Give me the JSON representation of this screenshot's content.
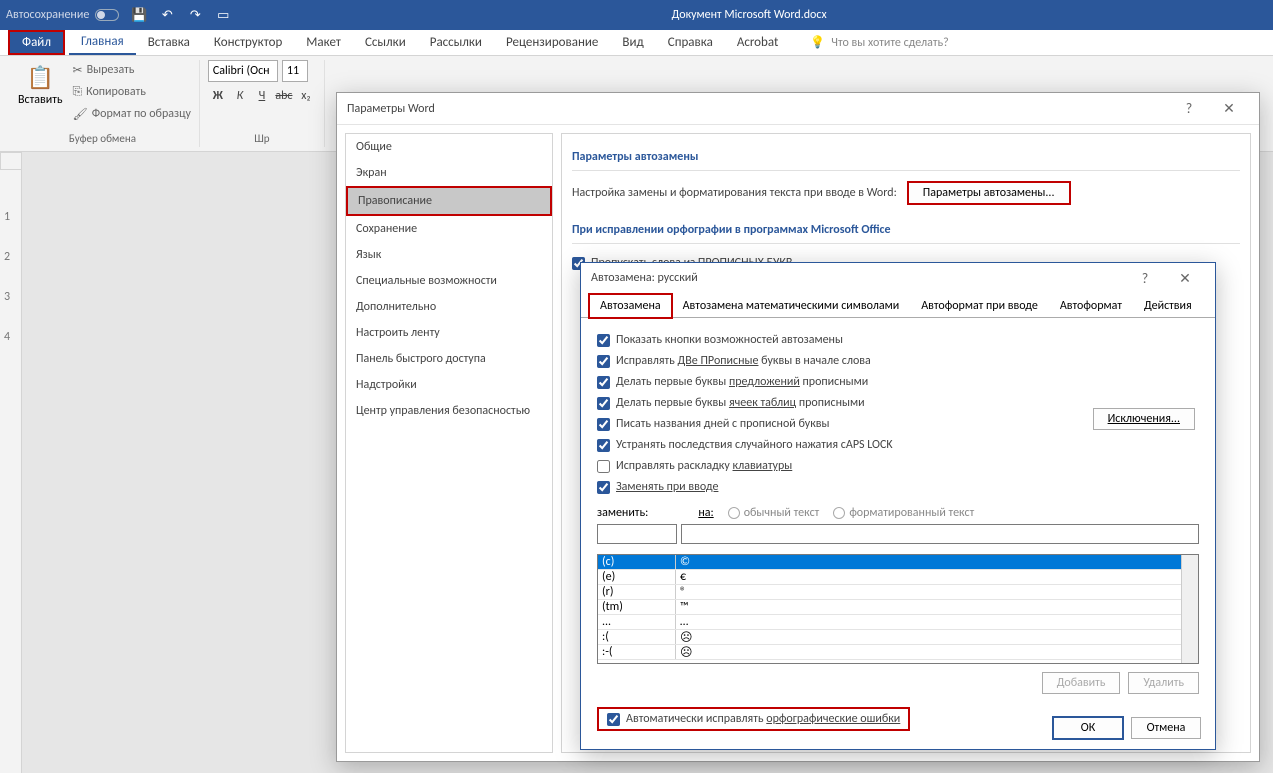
{
  "titlebar": {
    "autosave_label": "Автосохранение",
    "doc_title": "Документ Microsoft Word.docx"
  },
  "tabs": {
    "file": "Файл",
    "home": "Главная",
    "insert": "Вставка",
    "design": "Конструктор",
    "layout": "Макет",
    "references": "Ссылки",
    "mailings": "Рассылки",
    "review": "Рецензирование",
    "view": "Вид",
    "help": "Справка",
    "acrobat": "Acrobat",
    "tell_me": "Что вы хотите сделать?"
  },
  "ribbon": {
    "paste": "Вставить",
    "cut": "Вырезать",
    "copy": "Копировать",
    "format_painter": "Формат по образцу",
    "clipboard_group": "Буфер обмена",
    "font_name": "Calibri (Осн",
    "font_size": "11",
    "font_group": "Шр"
  },
  "word_options": {
    "title": "Параметры Word",
    "sidebar": {
      "general": "Общие",
      "display": "Экран",
      "proofing": "Правописание",
      "save": "Сохранение",
      "language": "Язык",
      "ease": "Специальные возможности",
      "advanced": "Дополнительно",
      "customize_ribbon": "Настроить ленту",
      "qat": "Панель быстрого доступа",
      "addins": "Надстройки",
      "trust": "Центр управления безопасностью"
    },
    "content": {
      "sec1": "Параметры автозамены",
      "sec1_text": "Настройка замены и форматирования текста при вводе в Word:",
      "sec1_btn": "Параметры автозамены...",
      "sec2": "При исправлении орфографии в программах Microsoft Office",
      "chk_caps": "Пропускать слова из ПРОПИСНЫХ БУКВ"
    }
  },
  "autocorrect": {
    "title": "Автозамена: русский",
    "tabs": {
      "auto": "Автозамена",
      "math": "Автозамена математическими символами",
      "afmt_type": "Автоформат при вводе",
      "afmt": "Автоформат",
      "actions": "Действия"
    },
    "show_buttons": "Показать кнопки возможностей автозамены",
    "correct_two_caps_a": "Исправлять ",
    "correct_two_caps_b": "ДВе ПРописные",
    "correct_two_caps_c": " буквы в начале слова",
    "capitalize_sentences_a": "Делать первые буквы ",
    "capitalize_sentences_b": "предложений",
    "capitalize_sentences_c": " прописными",
    "capitalize_cells_a": "Делать первые буквы ",
    "capitalize_cells_b": "ячеек таблиц",
    "capitalize_cells_c": " прописными",
    "capitalize_days": "Писать названия дней с прописной буквы",
    "correct_capslock": "Устранять последствия случайного нажатия cAPS LOCK",
    "correct_keyboard_a": "Исправлять раскладку ",
    "correct_keyboard_b": "клавиатуры",
    "replace_text": "Заменять при вводе",
    "exceptions_btn": "Исключения...",
    "replace_label": "заменить:",
    "with_label": "на:",
    "plain_text": "обычный текст",
    "formatted_text": "форматированный текст",
    "table": [
      {
        "l": "(c)",
        "r": "©"
      },
      {
        "l": "(e)",
        "r": "€"
      },
      {
        "l": "(r)",
        "r": "®"
      },
      {
        "l": "(tm)",
        "r": "™"
      },
      {
        "l": "...",
        "r": "…"
      },
      {
        "l": ":(",
        "r": "☹"
      },
      {
        "l": ":-(",
        "r": "☹"
      }
    ],
    "add_btn": "Добавить",
    "delete_btn": "Удалить",
    "auto_spell_a": "Автоматически исправлять ",
    "auto_spell_b": "орфографические ошибки",
    "ok": "ОК",
    "cancel": "Отмена"
  }
}
